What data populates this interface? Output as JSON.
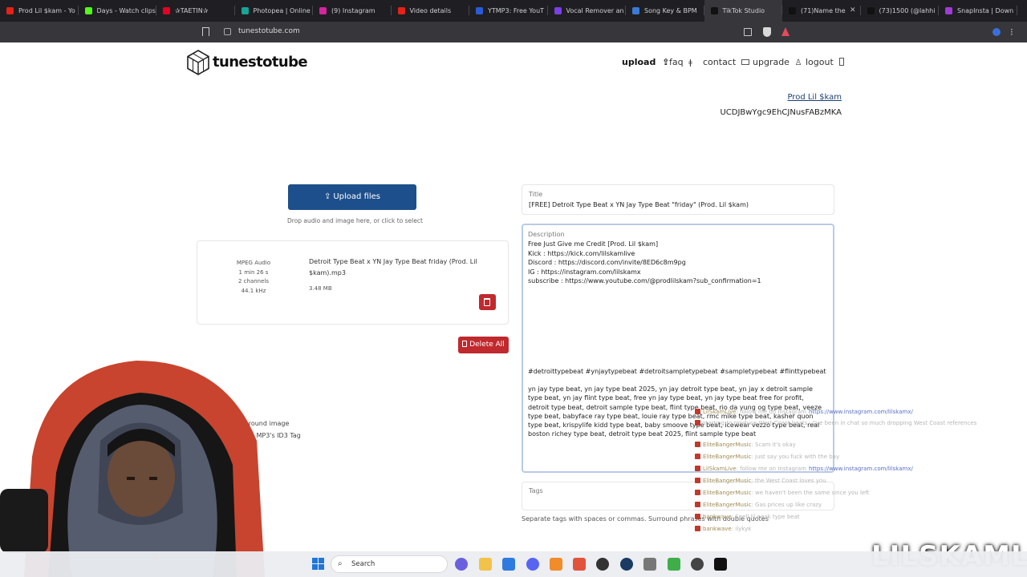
{
  "browser": {
    "tabs": [
      {
        "title": "Prod Lil $kam - Yo",
        "color": "#e62117",
        "active": false
      },
      {
        "title": "Days - Watch clips",
        "color": "#53fc18",
        "active": false
      },
      {
        "title": "✰TAETIN✰",
        "color": "#e60023",
        "active": false
      },
      {
        "title": "Photopea | Online",
        "color": "#18a497",
        "active": false
      },
      {
        "title": "(9) Instagram",
        "color": "#d6249f",
        "active": false
      },
      {
        "title": "Video details",
        "color": "#e62117",
        "active": false
      },
      {
        "title": "YTMP3: Free YouT",
        "color": "#2a5bd7",
        "active": false
      },
      {
        "title": "Vocal Remover an",
        "color": "#7b3fe4",
        "active": false
      },
      {
        "title": "Song Key & BPM",
        "color": "#3a7bd5",
        "active": false
      },
      {
        "title": "TikTok Studio",
        "color": "#111111",
        "active": true
      },
      {
        "title": "(71)Name the",
        "color": "#111111",
        "active": false
      },
      {
        "title": "(73)1500 (@lahhi",
        "color": "#111111",
        "active": false
      },
      {
        "title": "SnapInsta | Down",
        "color": "#a13bd8",
        "active": false
      }
    ],
    "url": "tunestotube.com"
  },
  "site": {
    "logo": "tunestotube",
    "nav": {
      "upload": "upload",
      "faq": "faq",
      "contact": "contact",
      "upgrade": "upgrade",
      "logout": "logout"
    },
    "channel_name": "Prod Lil $kam",
    "channel_id": "UCDJBwYgc9EhCJNusFABzMKA"
  },
  "upload": {
    "button_label": "Upload files",
    "hint": "Drop audio and image here, or click to select",
    "delete_all": "Delete All",
    "file": {
      "type": "MPEG Audio",
      "duration": "1 min 26 s",
      "channels": "2 channels",
      "rate": "44.1 kHz",
      "name": "Detroit Type Beat x YN Jay Type Beat friday (Prod. Lil $kam).mp3",
      "size": "3.48 MB"
    },
    "options": {
      "bg_image": "kground image",
      "id3": "e MP3's ID3 Tag"
    }
  },
  "form": {
    "title_label": "Title",
    "title_value": "[FREE] Detroit Type Beat x YN Jay Type Beat \"friday\" (Prod. Lil $kam)",
    "description_label": "Description",
    "description_lines": [
      "Free Just Give me Credit [Prod. Lil $kam]",
      "Kick : https://kick.com/lilskamlive",
      "Discord : https://discord.com/invite/8ED6c8m9pg",
      "IG : https://instagram.com/lilskamx",
      "subscribe : https://www.youtube.com/@prodlilskam?sub_confirmation=1"
    ],
    "hashtags": "#detroittypebeat #ynjaytypebeat #detroitsampletypebeat #sampletypebeat #flinttypebeat",
    "keywords": "yn jay type beat, yn jay type beat 2025, yn jay detroit type beat, yn jay x detroit sample type beat, yn jay flint type beat, free yn jay type beat, yn jay type beat free for profit, detroit type beat, detroit sample type beat, flint type beat, rio da yung og type beat, veeze type beat, babyface ray type beat, louie ray type beat, rmc mike type beat, kasher quon type beat, krispylife kidd type beat, baby smoove type beat, icewear vezzo type beat, real boston richey type beat, detroit type beat 2025, flint sample type beat",
    "tags_label": "Tags",
    "tags_hint": "Separate tags with spaces or commas. Surround phrases with double quotes"
  },
  "overlay": {
    "chat": [
      {
        "user": "LilSkamLive",
        "text": ": follow me on Instagram",
        "link": "https://www.instagram.com/lilskamx/"
      },
      {
        "user": "",
        "text": "starting to produce West Coast beats · I've been in chat so much dropping West Coast references",
        "link": ""
      },
      {
        "user": "EliteBangerMusic",
        "text": ": Scam it's okay",
        "link": ""
      },
      {
        "user": "EliteBangerMusic",
        "text": ": just say you fuck with the bay",
        "link": ""
      },
      {
        "user": "LilSkamLive",
        "text": ": follow me on Instagram",
        "link": "https://www.instagram.com/lilskamx/"
      },
      {
        "user": "EliteBangerMusic",
        "text": ": the West Coast loves you",
        "link": ""
      },
      {
        "user": "EliteBangerMusic",
        "text": ": we haven't been the same since you left",
        "link": ""
      },
      {
        "user": "EliteBangerMusic",
        "text": ": Gas prices up like crazy",
        "link": ""
      },
      {
        "user": "bankwave",
        "text": ": Spell lil peak type beat",
        "link": ""
      },
      {
        "user": "bankwave",
        "text": ": ilykyk",
        "link": ""
      }
    ],
    "watermark": "LILSKAMLIVE"
  },
  "taskbar": {
    "search_label": "Search"
  },
  "colors": {
    "primary": "#1d4f8c",
    "danger": "#c0292d",
    "focus": "#b9cbe6"
  }
}
